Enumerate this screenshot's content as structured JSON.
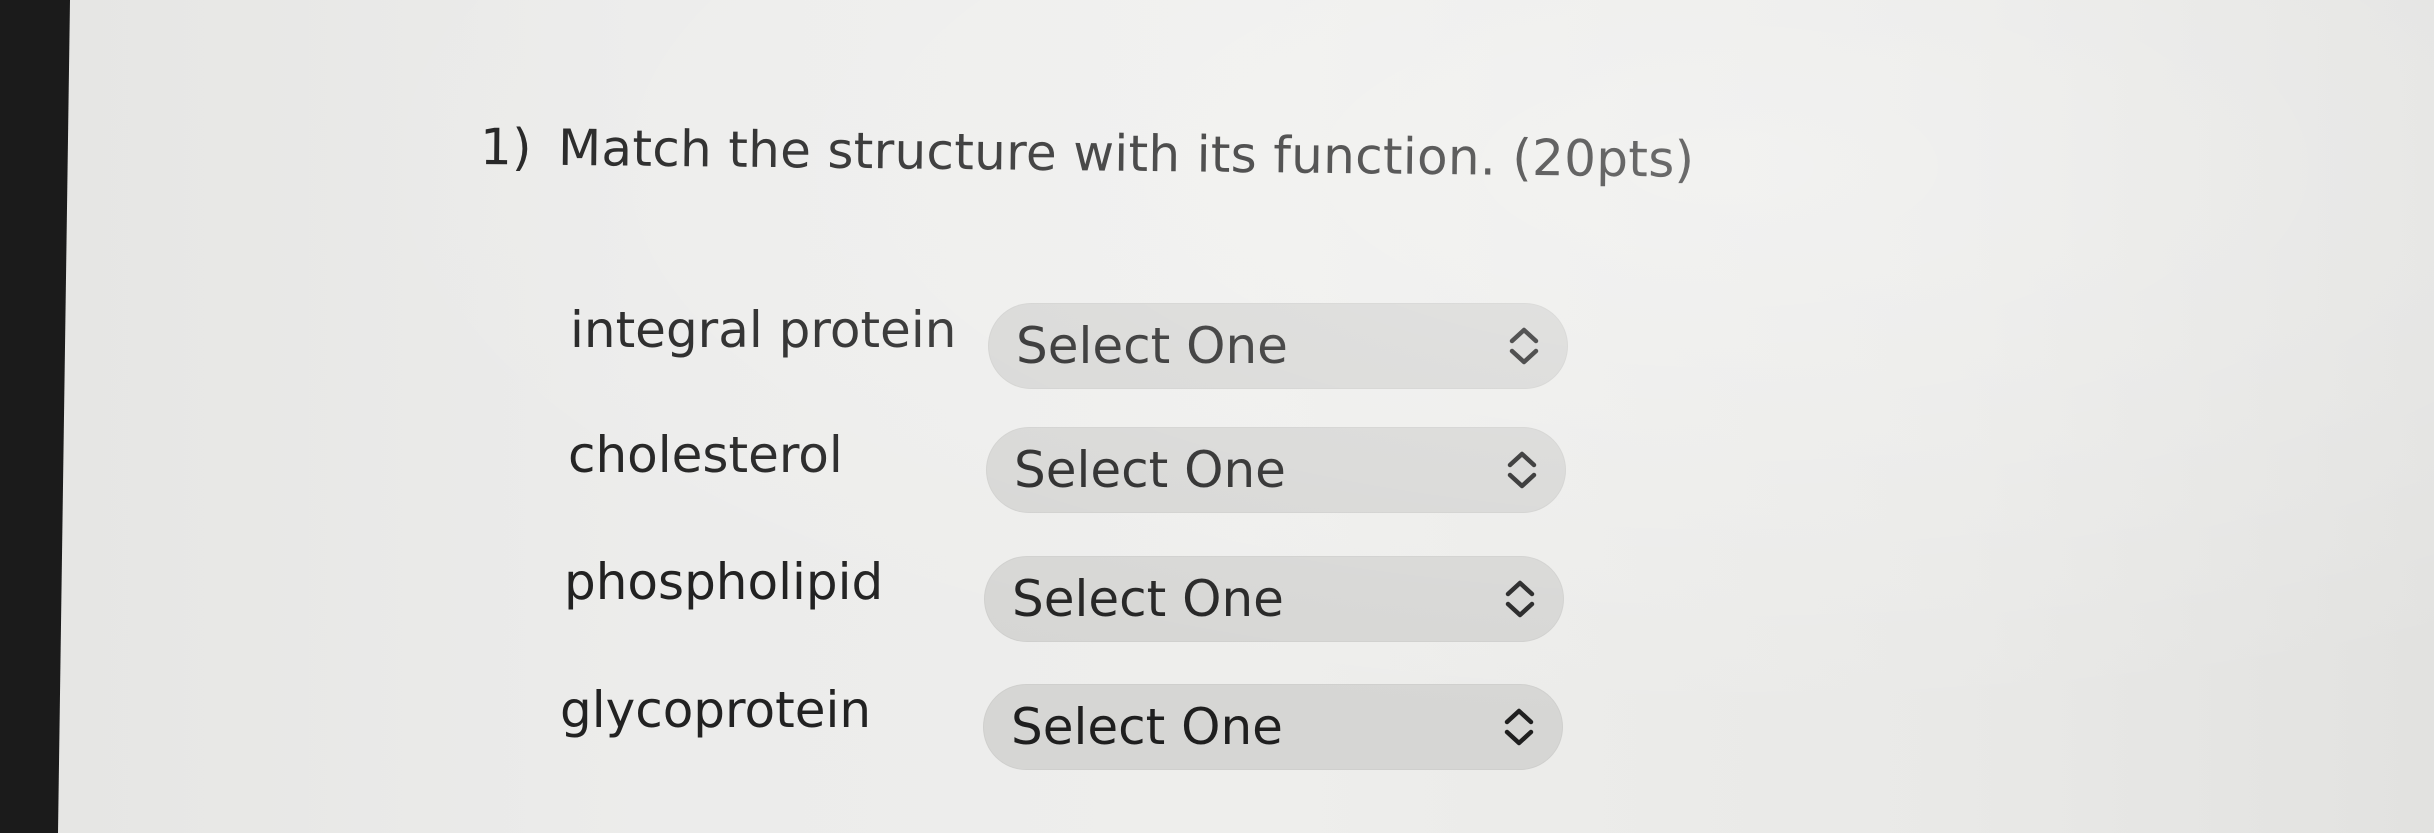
{
  "question": {
    "number": "1)",
    "text": "Match the structure  with its function. (20pts)"
  },
  "rows": [
    {
      "label": "integral protein",
      "selected": "Select One"
    },
    {
      "label": "cholesterol",
      "selected": "Select One"
    },
    {
      "label": "phospholipid",
      "selected": "Select One"
    },
    {
      "label": "glycoprotein",
      "selected": "Select One"
    }
  ],
  "icons": {
    "select_indicator": "chevron-up-down-icon"
  },
  "colors": {
    "screen_bg": "#ececeb",
    "select_bg": "#d6d6d4",
    "text": "#1e1e1e"
  }
}
